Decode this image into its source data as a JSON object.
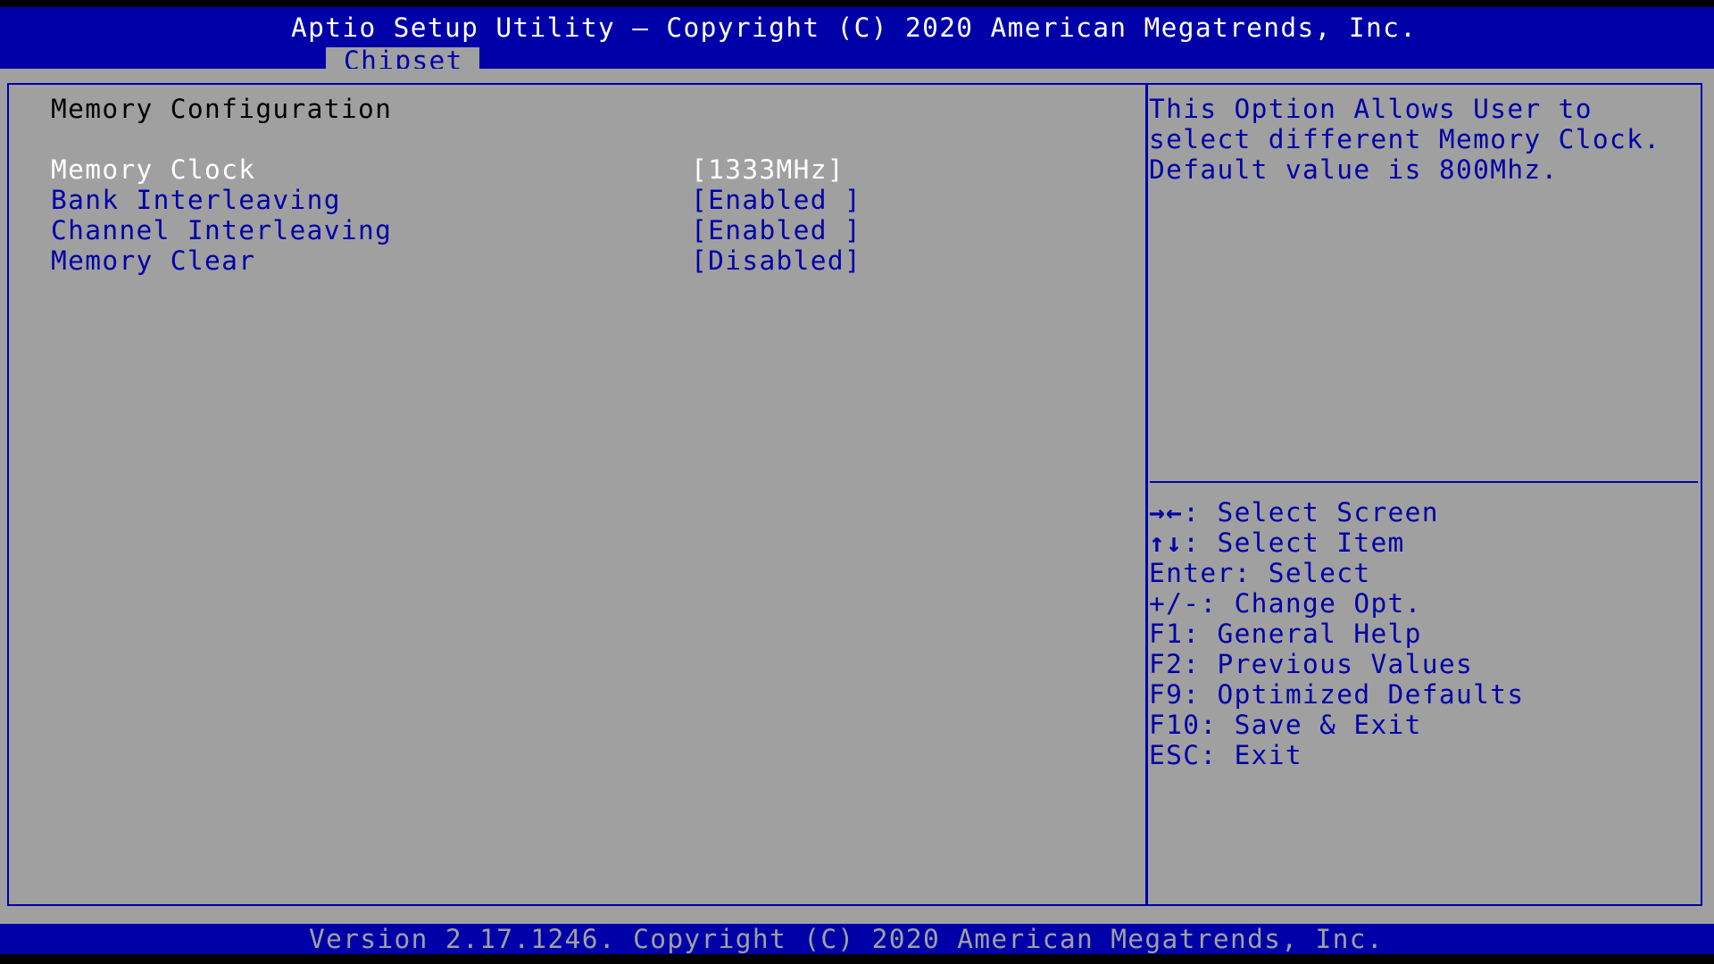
{
  "header": {
    "title": "Aptio Setup Utility – Copyright (C) 2020 American Megatrends, Inc.",
    "active_tab": "Chipset"
  },
  "main": {
    "section_title": "Memory Configuration",
    "settings": [
      {
        "label": "Memory Clock",
        "value": "[1333MHz]",
        "selected": true
      },
      {
        "label": "Bank Interleaving",
        "value": "[Enabled ]",
        "selected": false
      },
      {
        "label": "Channel Interleaving",
        "value": "[Enabled ]",
        "selected": false
      },
      {
        "label": "Memory Clear",
        "value": "[Disabled]",
        "selected": false
      }
    ]
  },
  "help": {
    "description": [
      "This Option Allows User to",
      "select different Memory Clock.",
      "Default value is 800Mhz."
    ],
    "keys": [
      {
        "key": "→←",
        "action": ": Select Screen",
        "icon": "left-right-arrows-icon"
      },
      {
        "key": "↑↓",
        "action": ": Select Item",
        "icon": "up-down-arrows-icon"
      },
      {
        "key": "Enter",
        "action": ": Select"
      },
      {
        "key": "+/-",
        "action": ": Change Opt."
      },
      {
        "key": "F1",
        "action": ": General Help"
      },
      {
        "key": "F2",
        "action": ": Previous Values"
      },
      {
        "key": "F9",
        "action": ": Optimized Defaults"
      },
      {
        "key": "F10",
        "action": ": Save & Exit"
      },
      {
        "key": "ESC",
        "action": ": Exit"
      }
    ]
  },
  "footer": {
    "text": "Version 2.17.1246. Copyright (C) 2020 American Megatrends, Inc."
  },
  "colors": {
    "background": "#a0a0a0",
    "accent_blue": "#0000a8",
    "highlight": "#ffffff",
    "text": "#000000"
  }
}
